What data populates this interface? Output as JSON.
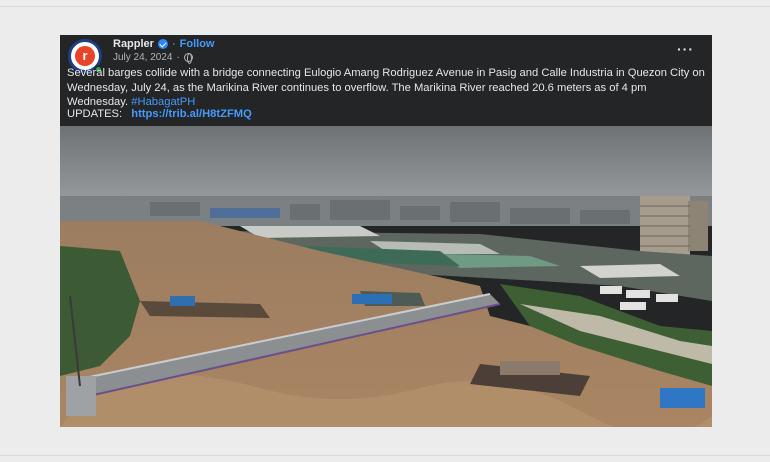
{
  "post": {
    "page_name": "Rappler",
    "separator": "·",
    "follow_label": "Follow",
    "date": "July 24, 2024",
    "date_separator": "·",
    "avatar_letter": "r",
    "more_label": "···",
    "caption": "Several barges collide with a bridge connecting Eulogio Amang Rodriguez Avenue in Pasig and Calle Industria in Quezon City on Wednesday, July 24, as the Marikina River continues to overflow. The Marikina River reached 20.6 meters as of 4 pm Wednesday.",
    "hashtag": "#HabagatPH",
    "updates_label": "UPDATES:",
    "updates_link": "https://trib.al/H8tZFMQ"
  },
  "colors": {
    "post_bg": "#242526",
    "text": "#e4e6eb",
    "link": "#4599ff",
    "muted": "#b0b3b8",
    "brand_orange": "#e8442a",
    "brand_blue": "#1b3f82",
    "flood_water": "#a98563"
  },
  "icons": [
    "verified-badge-icon",
    "globe-icon",
    "more-options-icon"
  ]
}
